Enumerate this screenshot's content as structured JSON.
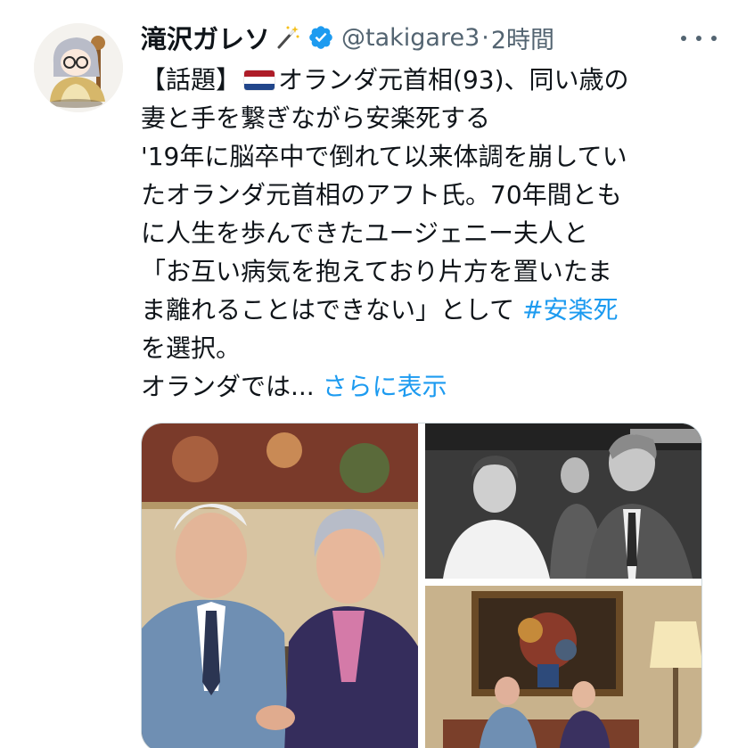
{
  "user": {
    "display_name": "滝沢ガレソ",
    "handle": "@takigare3",
    "separator": "·",
    "time": "2時間"
  },
  "icons": {
    "avatar": "avatar-illustration",
    "wand": "magic-wand-icon",
    "verified": "verified-badge-icon",
    "more": "more-options-icon",
    "flag": "netherlands-flag-icon"
  },
  "tweet": {
    "line1_prefix": "【話題】",
    "line1_suffix": "オランダ元首相(93)、同い歳の",
    "line2": "妻と手を繋ぎながら安楽死する",
    "line3": "'19年に脳卒中で倒れて以来体調を崩してい",
    "line4": "たオランダ元首相のアフト氏。70年間とも",
    "line5": "に人生を歩んできたユージェニー夫人と",
    "line6": "「お互い病気を抱えており片方を置いたま",
    "line7_text": "ま離れることはできない」として ",
    "hashtag": "#安楽死",
    "line8": "を選択。",
    "line9_text": "オランダでは... ",
    "show_more": "さらに表示"
  },
  "colors": {
    "text": "#0f1419",
    "secondary": "#536471",
    "link": "#1d9bf0",
    "verified": "#1d9bf0"
  }
}
